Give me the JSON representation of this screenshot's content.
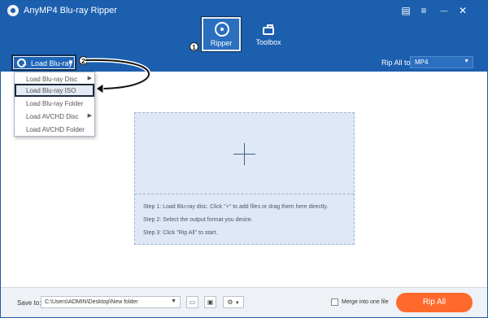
{
  "window": {
    "title": "AnyMP4 Blu-ray Ripper",
    "controls": [
      {
        "icon": "feedback-icon",
        "glyph": "▤"
      },
      {
        "icon": "menu-icon",
        "glyph": "≡"
      },
      {
        "icon": "minimize-icon",
        "glyph": "—"
      },
      {
        "icon": "close-icon",
        "glyph": "✕"
      }
    ]
  },
  "tabs": {
    "ripper": "Ripper",
    "toolbox": "Toolbox"
  },
  "callouts": [
    "1",
    "2"
  ],
  "toolbar": {
    "load_label": "Load Blu-ray",
    "rip_all_to_label": "Rip All to:",
    "rip_all_to_value": "MP4"
  },
  "load_menu": {
    "items": [
      {
        "label": "Load Blu-ray Disc",
        "has_submenu": true,
        "selected": false
      },
      {
        "label": "Load Blu-ray ISO",
        "has_submenu": false,
        "selected": true
      },
      {
        "label": "Load Blu-ray Folder",
        "has_submenu": false,
        "selected": false
      },
      {
        "label": "Load AVCHD Disc",
        "has_submenu": true,
        "selected": false
      },
      {
        "label": "Load AVCHD Folder",
        "has_submenu": false,
        "selected": false
      }
    ]
  },
  "drop_zone": {
    "steps": [
      "Step 1: Load Blu-ray disc. Click \"+\" to add files or drag them here directly.",
      "Step 2: Select the output format you desire.",
      "Step 3: Click \"Rip All\" to start."
    ]
  },
  "bottom": {
    "save_to_label": "Save to:",
    "save_path": "C:\\Users\\ADMIN\\Desktop\\New folder",
    "merge_label": "Merge into one file",
    "merge_checked": false,
    "rip_all_label": "Rip All"
  },
  "colors": {
    "header_blue": "#1b5fae",
    "accent_orange": "#ff6a2c",
    "drop_zone_bg": "#dfe8f6"
  }
}
